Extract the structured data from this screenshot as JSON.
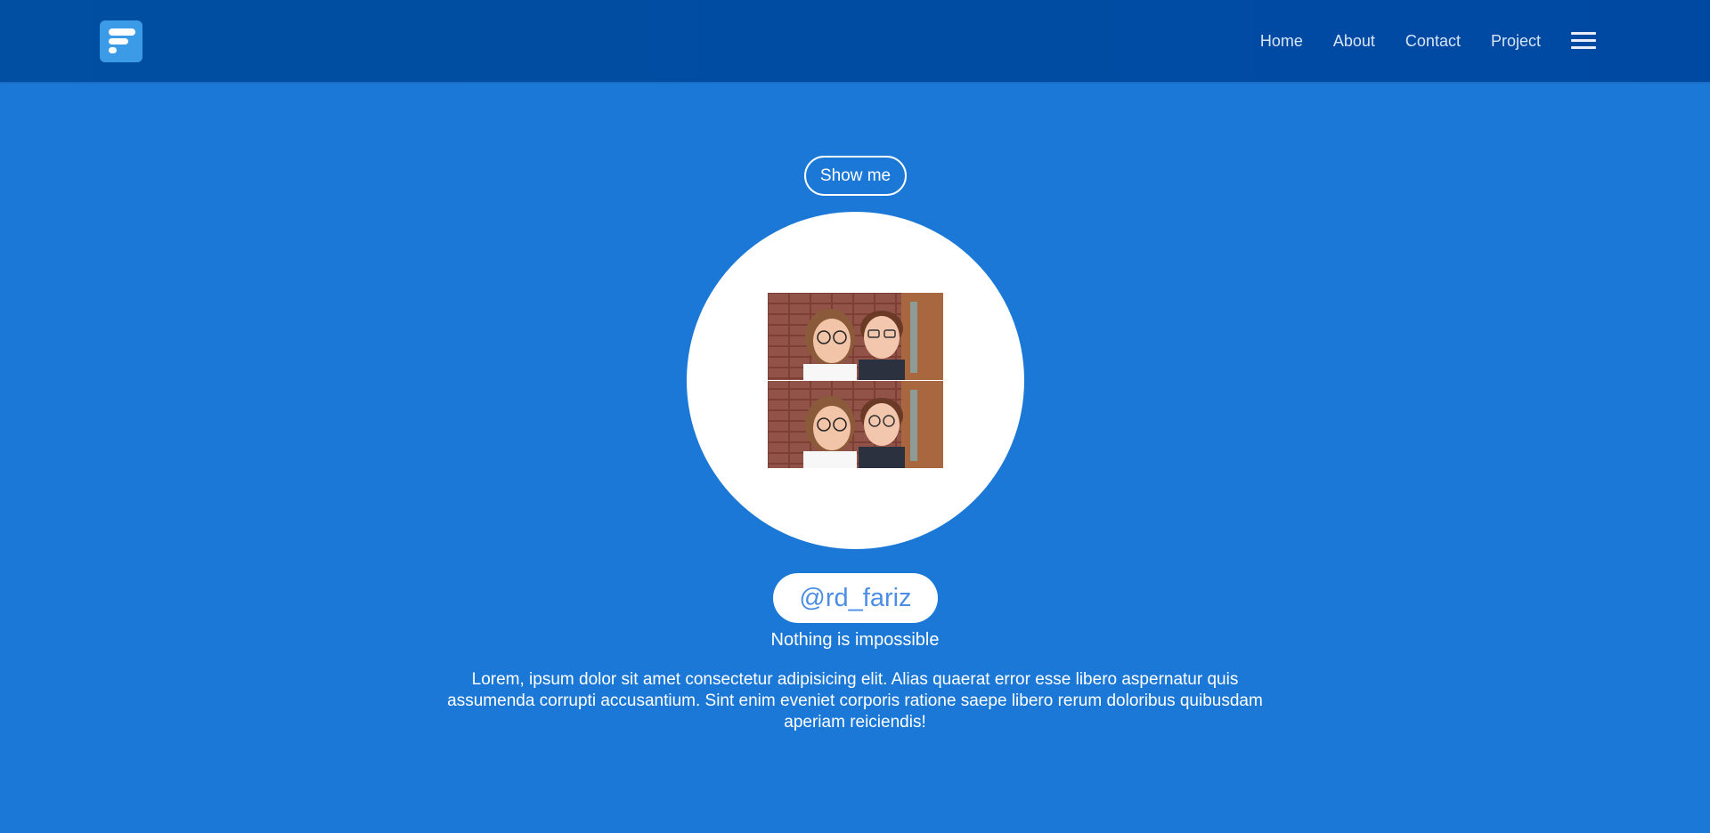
{
  "nav": {
    "links": [
      "Home",
      "About",
      "Contact",
      "Project"
    ]
  },
  "hero": {
    "button_label": "Show me",
    "username": "@rd_fariz",
    "tagline": "Nothing is impossible",
    "description": "Lorem, ipsum dolor sit amet consectetur adipisicing elit. Alias quaerat error esse libero aspernatur quis assumenda corrupti accusantium. Sint enim eveniet corporis ratione saepe libero rerum doloribus quibusdam aperiam reiciendis!"
  },
  "colors": {
    "background": "#1b78d6",
    "navbar": "#004fa2",
    "accent": "#3b9be6",
    "username_text": "#4c8ee6"
  },
  "icons": {
    "logo": "logo-icon",
    "menu": "hamburger-menu-icon"
  }
}
